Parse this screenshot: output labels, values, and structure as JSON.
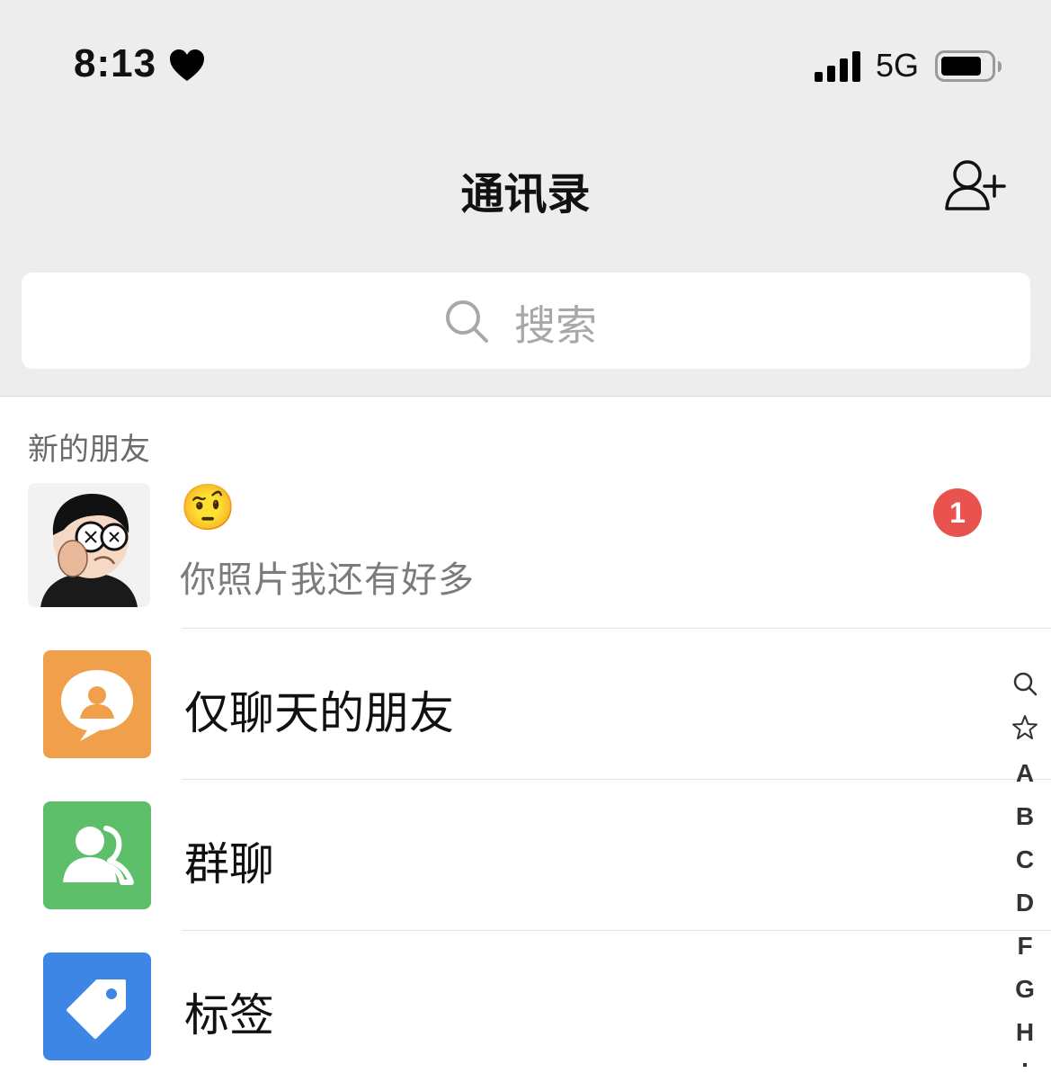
{
  "status_bar": {
    "time": "8:13",
    "network": "5G",
    "icons": [
      "heart-icon",
      "signal-icon",
      "battery-icon"
    ]
  },
  "nav": {
    "title": "通讯录",
    "add_icon": "add-contact-icon"
  },
  "search": {
    "placeholder": "搜索",
    "icon": "search-icon"
  },
  "new_friends": {
    "section_label": "新的朋友",
    "request": {
      "name_emoji": "🤨",
      "message": "你照片我还有好多",
      "badge": "1"
    }
  },
  "menu": [
    {
      "label": "仅聊天的朋友",
      "icon": "chat-only-friends-icon",
      "color": "#f0a04b"
    },
    {
      "label": "群聊",
      "icon": "group-chat-icon",
      "color": "#5dbf6a"
    },
    {
      "label": "标签",
      "icon": "tag-icon",
      "color": "#3d86e6"
    }
  ],
  "index_bar": [
    "search",
    "star",
    "A",
    "B",
    "C",
    "D",
    "F",
    "G",
    "H",
    "I"
  ]
}
